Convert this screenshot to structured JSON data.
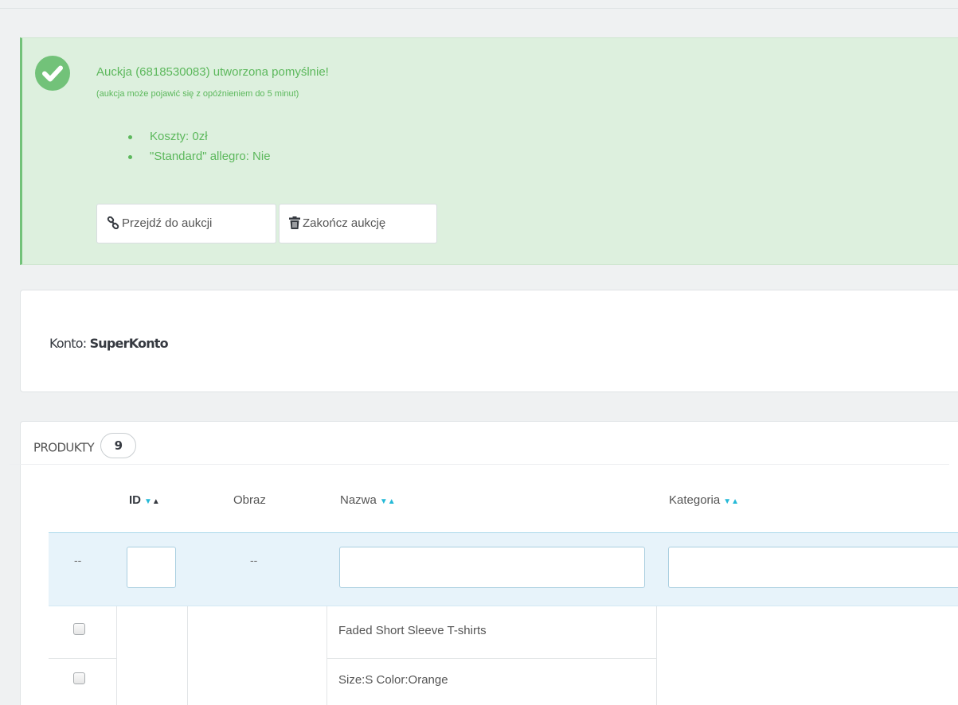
{
  "alert": {
    "title": "Auckja (6818530083) utworzona pomyślnie!",
    "subtitle": "(aukcja może pojawić się z opóźnieniem do 5 minut)",
    "items": [
      "Koszty: 0zł",
      "\"Standard\" allegro: Nie"
    ],
    "buttons": {
      "goto_label": "Przejdź do aukcji",
      "end_label": "Zakończ aukcję"
    },
    "colors": {
      "background": "#ddf0de",
      "accent": "#72c279",
      "text": "#5cb85c"
    }
  },
  "account": {
    "label": "Konto:",
    "name": "SuperKonto"
  },
  "products": {
    "title": "PRODUKTY",
    "count": "9",
    "columns": [
      {
        "label": "ID",
        "sortable": true
      },
      {
        "label": "Obraz",
        "sortable": false
      },
      {
        "label": "Nazwa",
        "sortable": true
      },
      {
        "label": "Kategoria",
        "sortable": true
      }
    ],
    "filters": {
      "checkbox_placeholder": "--",
      "image_placeholder": "--",
      "id_value": "",
      "name_value": "",
      "category_value": ""
    },
    "rows": [
      {
        "name": "Faded Short Sleeve T-shirts"
      },
      {
        "name": "Size:S Color:Orange"
      }
    ],
    "colors": {
      "sort_arrow": "#25b9d7",
      "filter_row_bg": "#e7f3fa"
    }
  }
}
